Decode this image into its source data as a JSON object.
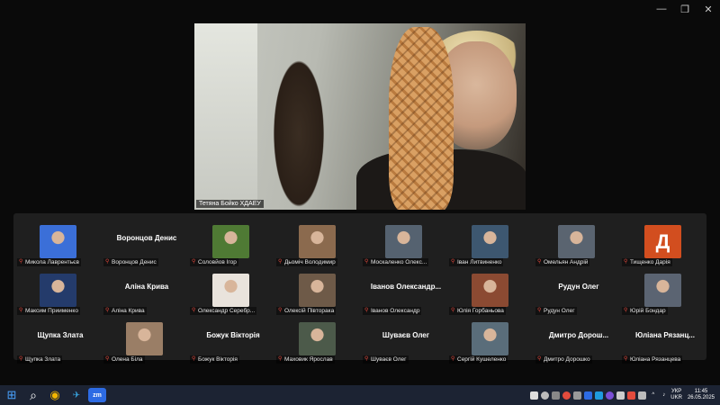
{
  "window": {
    "minimize": "—",
    "restore": "❐",
    "close": "✕"
  },
  "speaker": {
    "name": "Тетяна Бойко ХДАЕУ"
  },
  "participants": [
    {
      "label": "Микола Лаврентьєв",
      "big_name": "",
      "thumb": "photo",
      "color": "#3b6fd8"
    },
    {
      "label": "Воронцов Денис",
      "big_name": "Воронцов Денис",
      "thumb": "",
      "color": ""
    },
    {
      "label": "Соловйов Ігор",
      "big_name": "",
      "thumb": "photo",
      "color": "#4f7a34"
    },
    {
      "label": "Дьомiч Володимир",
      "big_name": "",
      "thumb": "photo",
      "color": "#8b6a4e"
    },
    {
      "label": "Москаленко Олекс...",
      "big_name": "",
      "thumb": "photo",
      "color": "#556270"
    },
    {
      "label": "Іван Литвиненко",
      "big_name": "",
      "thumb": "photo",
      "color": "#3d5770"
    },
    {
      "label": "Омельян Андрій",
      "big_name": "",
      "thumb": "photo",
      "color": "#5a6470"
    },
    {
      "label": "Тищенко Дарія",
      "big_name": "",
      "thumb": "avatar",
      "letter": "Д",
      "color": "#d24e1f"
    },
    {
      "label": "Максим Приименко",
      "big_name": "",
      "thumb": "photo",
      "color": "#243b6b"
    },
    {
      "label": "Аліна Крива",
      "big_name": "Аліна Крива",
      "thumb": "",
      "color": ""
    },
    {
      "label": "Олександр Серебр...",
      "big_name": "",
      "thumb": "photo",
      "color": "#e9e3dc"
    },
    {
      "label": "Олексій Півторака",
      "big_name": "",
      "thumb": "photo",
      "color": "#6e5a48"
    },
    {
      "label": "Іванов Олександр",
      "big_name": "Іванов Олександр...",
      "thumb": "",
      "color": ""
    },
    {
      "label": "Юлія Горбаньова",
      "big_name": "",
      "thumb": "photo",
      "color": "#8b4a32"
    },
    {
      "label": "Рудун Олег",
      "big_name": "Рудун Олег",
      "thumb": "",
      "color": ""
    },
    {
      "label": "Юрій Бондар",
      "big_name": "",
      "thumb": "photo",
      "color": "#5b6472"
    },
    {
      "label": "Щупка Злата",
      "big_name": "Щупка Злата",
      "thumb": "",
      "color": ""
    },
    {
      "label": "Олена Біла",
      "big_name": "",
      "thumb": "photo",
      "color": "#9a7e66"
    },
    {
      "label": "Божук Вікторія",
      "big_name": "Божук Вікторія",
      "thumb": "",
      "color": ""
    },
    {
      "label": "Маховик Ярослав",
      "big_name": "",
      "thumb": "photo",
      "color": "#4c5a4a"
    },
    {
      "label": "Шуваєв Олег",
      "big_name": "Шуваєв Олег",
      "thumb": "",
      "color": ""
    },
    {
      "label": "Сергій Кушеленко",
      "big_name": "",
      "thumb": "photo",
      "color": "#5a6d7a"
    },
    {
      "label": "Дмитро Дорошко",
      "big_name": "Дмитро Дорош...",
      "thumb": "",
      "color": ""
    },
    {
      "label": "Юліана Рязанцева",
      "big_name": "Юліана Рязанц...",
      "thumb": "",
      "color": ""
    }
  ],
  "taskbar": {
    "start": "⊞",
    "search": "⌕",
    "chrome": "◉",
    "telegram": "✈",
    "zoom": "zm",
    "lang_top": "УКР",
    "lang_bottom": "UKR",
    "time": "11:45",
    "date": "26.05.2025"
  }
}
